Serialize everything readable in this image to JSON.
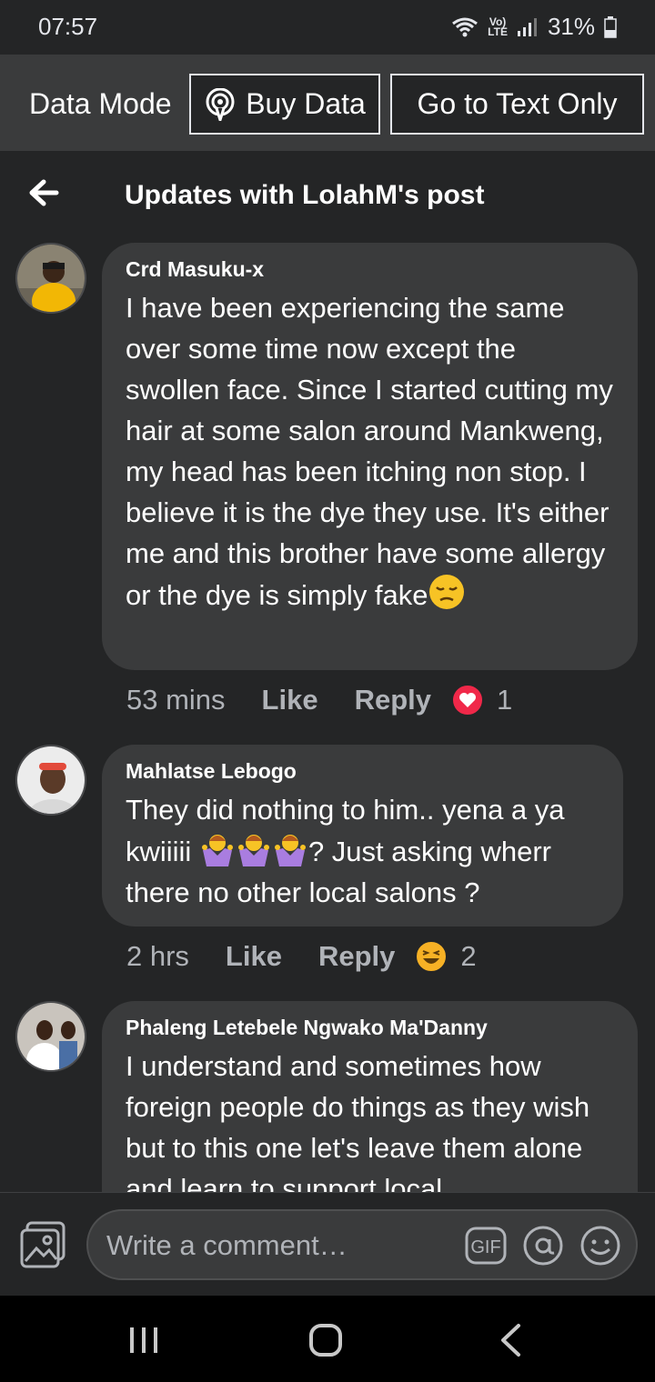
{
  "status": {
    "time": "07:57",
    "network": "LTE",
    "battery": "31%"
  },
  "data_bar": {
    "label": "Data Mode",
    "buy_data": "Buy Data",
    "text_only": "Go to Text Only"
  },
  "header": {
    "title": "Updates with LolahM's post"
  },
  "comments": [
    {
      "name": "Crd Masuku-x",
      "text": "I have been experiencing the same over some time now except the swollen face. Since I started cutting my hair at some salon around Mankweng, my head has been itching non stop. I believe it is the dye they use. It's either me and this brother have some allergy or the dye is simply fake",
      "time": "53 mins",
      "like": "Like",
      "reply": "Reply",
      "reaction": "heart-reaction-icon",
      "reaction_count": "1"
    },
    {
      "name": "Mahlatse Lebogo",
      "text_a": "They did nothing to him.. yena a ya kwiiiii ",
      "text_b": "? Just asking wherr there no other local salons ?",
      "time": "2 hrs",
      "like": "Like",
      "reply": "Reply",
      "reaction": "laughing-reaction-icon",
      "reaction_count": "2"
    },
    {
      "name": "Phaleng Letebele Ngwako Ma'Danny",
      "text": "I understand and sometimes how foreign people do things as they wish but to this one let's leave them alone and learn to support local"
    }
  ],
  "composer": {
    "placeholder": "Write a comment…",
    "gif": "GIF"
  },
  "colors": {
    "background": "#242526",
    "bubble": "#3a3b3c",
    "heart": "#f02849",
    "laugh": "#f7b125"
  }
}
